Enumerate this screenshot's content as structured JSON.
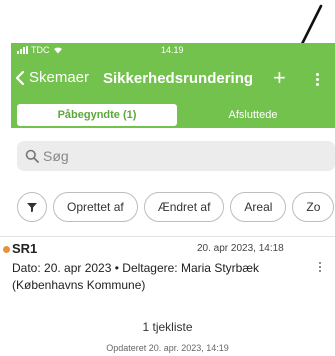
{
  "status_bar": {
    "carrier": "TDC",
    "time": "14.19"
  },
  "nav": {
    "back_label": "Skemaer",
    "title": "Sikkerhedsrundering",
    "add_symbol": "+"
  },
  "tabs": [
    {
      "label": "Påbegyndte (1)",
      "active": true
    },
    {
      "label": "Afsluttede",
      "active": false
    }
  ],
  "search": {
    "placeholder": "Søg"
  },
  "filters": [
    "Oprettet af",
    "Ændret af",
    "Areal",
    "Zo"
  ],
  "items": [
    {
      "name": "SR1",
      "date": "20. apr 2023, 14:18",
      "description": "Dato: 20. apr 2023 • Deltagere: Maria Styrbæk (Københavns Kommune)",
      "checklist": "1 tjekliste",
      "updated": "Opdateret 20. apr. 2023, 14:19"
    }
  ],
  "colors": {
    "brand_green": "#73c24d",
    "status_dot": "#e8913a"
  }
}
